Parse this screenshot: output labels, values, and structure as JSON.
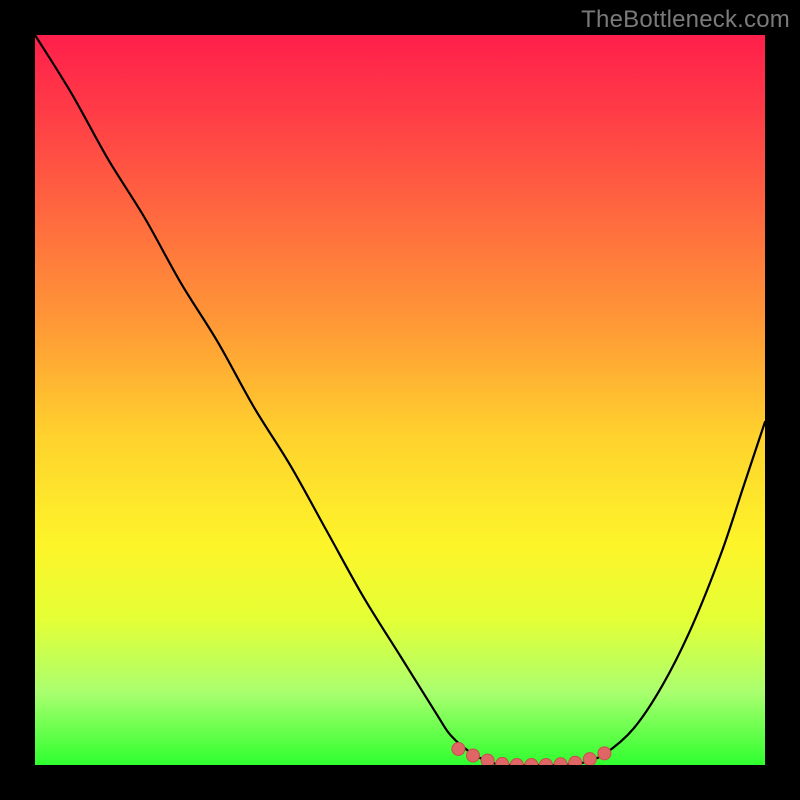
{
  "watermark": "TheBottleneck.com",
  "colors": {
    "frame": "#000000",
    "curve": "#000000",
    "marker_fill": "#e06666",
    "marker_stroke": "#c94d4d"
  },
  "chart_data": {
    "type": "line",
    "title": "",
    "xlabel": "",
    "ylabel": "",
    "xlim": [
      0,
      100
    ],
    "ylim": [
      0,
      100
    ],
    "x": [
      0,
      5,
      10,
      15,
      20,
      25,
      30,
      35,
      40,
      45,
      50,
      55,
      57,
      60,
      63,
      66,
      69,
      72,
      75,
      78,
      82,
      86,
      90,
      94,
      97,
      100
    ],
    "values": [
      100,
      92,
      83,
      75,
      66,
      58,
      49,
      41,
      32,
      23,
      15,
      7,
      4,
      1.5,
      0.2,
      0,
      0,
      0,
      0.3,
      1.5,
      5,
      11,
      19,
      29,
      38,
      47
    ],
    "markers": {
      "x": [
        58,
        60,
        62,
        64,
        66,
        68,
        70,
        72,
        74,
        76,
        78
      ],
      "y": [
        2.2,
        1.3,
        0.6,
        0.15,
        0,
        0,
        0,
        0.1,
        0.3,
        0.8,
        1.6
      ]
    }
  }
}
